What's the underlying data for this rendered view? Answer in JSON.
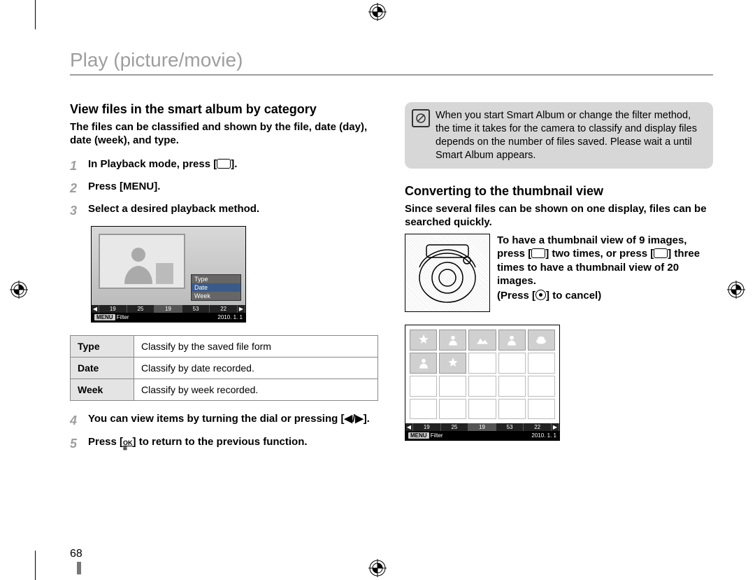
{
  "title": "Play (picture/movie)",
  "page_number": "68",
  "left": {
    "heading": "View files in the smart album by category",
    "lead": "The files can be classified and shown by the file, date (day), date (week), and type.",
    "steps": {
      "s1a": "In Playback mode, press [",
      "s1b": "].",
      "s2a": "Press [",
      "s2b": "MENU",
      "s2c": "].",
      "s3": "Select a desired playback method.",
      "s4": "You can view items by turning the dial or pressing [◀/▶].",
      "s5a": "Press [",
      "s5b": "] to return to the previous function."
    },
    "lcd": {
      "menu": {
        "a": "Type",
        "b": "Date",
        "c": "Week"
      },
      "dates": {
        "d1": "19",
        "d2": "25",
        "d3": "19",
        "d4": "53",
        "d5": "22"
      },
      "foot_menu": "MENU",
      "foot_filter": "Filter",
      "foot_date": "2010. 1. 1"
    },
    "table": {
      "r1h": "Type",
      "r1d": "Classify by the saved file form",
      "r2h": "Date",
      "r2d": "Classify by date recorded.",
      "r3h": "Week",
      "r3d": "Classify by week recorded."
    }
  },
  "right": {
    "note": "When you start Smart Album or change the filter method, the time it takes for the camera to classify and display files depends on the number of files saved. Please wait a until Smart Album appears.",
    "heading": "Converting to the thumbnail view",
    "lead": "Since several files can be shown on one display, files can be searched quickly.",
    "thumb_text_a": "To have a thumbnail view of 9 images, press [",
    "thumb_text_b": "] two times, or press [",
    "thumb_text_c": "] three times to have a thumbnail view of 20 images.",
    "thumb_text_d": "(Press [",
    "thumb_text_e": "] to cancel)",
    "grid_foot": {
      "menu": "MENU",
      "filter": "Filter",
      "date": "2010. 1. 1"
    },
    "grid_dates": {
      "d1": "19",
      "d2": "25",
      "d3": "19",
      "d4": "53",
      "d5": "22"
    }
  }
}
